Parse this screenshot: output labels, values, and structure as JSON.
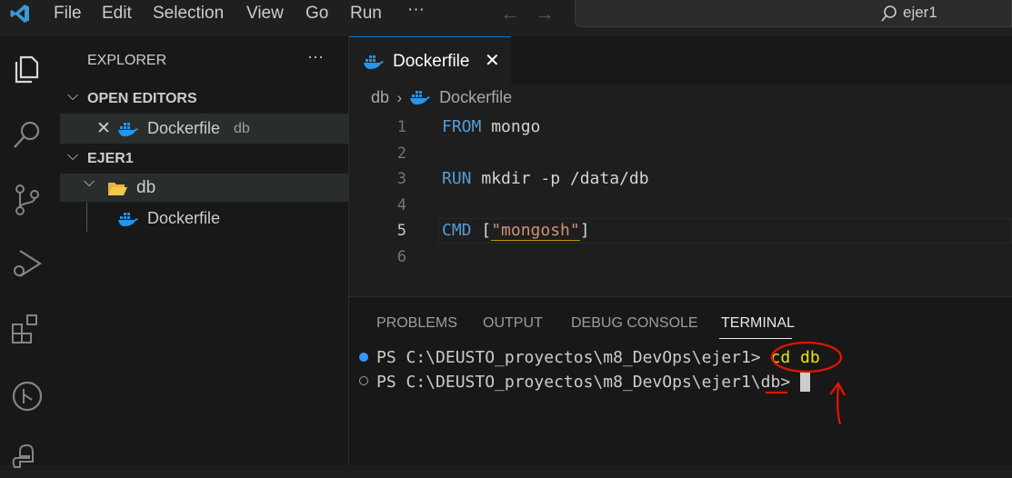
{
  "menu": [
    "File",
    "Edit",
    "Selection",
    "View",
    "Go",
    "Run",
    "···"
  ],
  "search": {
    "text": "ejer1"
  },
  "sidebar": {
    "title": "EXPLORER",
    "more": "···",
    "open_editors": {
      "heading": "OPEN EDITORS",
      "file": "Dockerfile",
      "folder_hint": "db"
    },
    "workspace": {
      "heading": "EJER1",
      "folder": "db",
      "file": "Dockerfile"
    }
  },
  "editor": {
    "tab_label": "Dockerfile",
    "breadcrumb": {
      "folder": "db",
      "file": "Dockerfile"
    },
    "lines": [
      {
        "num": "1",
        "keyword": "FROM",
        "rest": " mongo"
      },
      {
        "num": "2",
        "keyword": "",
        "rest": ""
      },
      {
        "num": "3",
        "keyword": "RUN",
        "rest": " mkdir -p /data/db"
      },
      {
        "num": "4",
        "keyword": "",
        "rest": ""
      },
      {
        "num": "5",
        "keyword": "CMD",
        "open": " [",
        "string": "\"mongosh\"",
        "close": "]"
      },
      {
        "num": "6",
        "keyword": "",
        "rest": ""
      }
    ]
  },
  "panel": {
    "tabs": [
      "PROBLEMS",
      "OUTPUT",
      "DEBUG CONSOLE",
      "TERMINAL"
    ],
    "active_tab": "TERMINAL",
    "terminal": {
      "line1_prompt": "PS C:\\DEUSTO_proyectos\\m8_DevOps\\ejer1>",
      "line1_cmd": "cd db",
      "line2_prompt_a": "PS C:\\DEUSTO_proyectos\\m8_DevOps\\ejer1\\",
      "line2_prompt_b": "db",
      "line2_prompt_c": ">"
    }
  },
  "colors": {
    "accent": "#0078d4",
    "keyword": "#569cd6",
    "string": "#ce9178",
    "annotation": "#e51400",
    "command": "#e5e510"
  }
}
